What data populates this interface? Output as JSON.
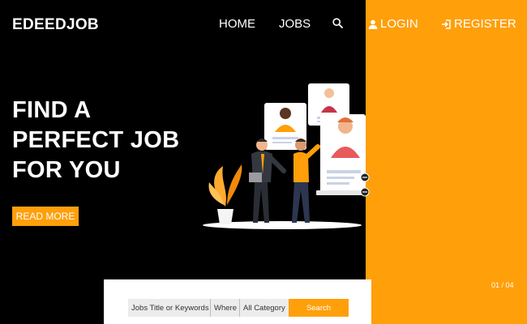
{
  "brand": {
    "logo": "EDEEDJOB"
  },
  "nav": {
    "home": "HOME",
    "jobs": "JOBS",
    "search_icon": "search-icon",
    "login": "LOGIN",
    "login_icon": "user-icon",
    "register": "REGISTER",
    "register_icon": "sign-in-icon"
  },
  "hero": {
    "headline_lines": [
      "FIND A",
      "PERFECT JOB",
      "FOR YOU"
    ],
    "cta": "READ MORE",
    "slide_counter": "01 / 04"
  },
  "search": {
    "keywords": "Jobs Title or Keywords",
    "where": "Where",
    "category": "All Category",
    "button": "Search"
  },
  "colors": {
    "accent": "#ff9f0a",
    "background": "#000000",
    "text_light": "#ffffff"
  }
}
